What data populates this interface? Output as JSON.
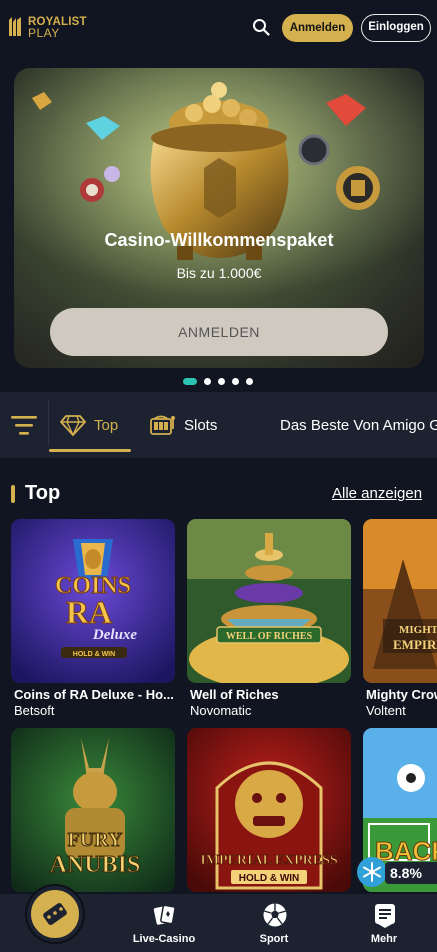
{
  "header": {
    "logo_line1": "ROYALIST",
    "logo_line2": "PLAY",
    "register_label": "Anmelden",
    "login_label": "Einloggen"
  },
  "banner": {
    "title": "Casino-Willkommenspaket",
    "subtitle": "Bis zu 1.000€",
    "cta_label": "ANMELDEN",
    "slides_total": 5,
    "active_slide": 1
  },
  "categories": [
    {
      "label": "Top",
      "icon": "diamond-icon",
      "active": true
    },
    {
      "label": "Slots",
      "icon": "slot-machine-icon",
      "active": false
    },
    {
      "label": "Das Beste Von Amigo G",
      "icon": "",
      "active": false
    }
  ],
  "section": {
    "title": "Top",
    "see_all_label": "Alle anzeigen"
  },
  "games": [
    {
      "name": "Coins of RA Deluxe - Ho...",
      "provider": "Betsoft",
      "art_text": [
        "COINS",
        "RA",
        "Deluxe",
        "HOLD & WIN"
      ]
    },
    {
      "name": "Well of Riches",
      "provider": "Novomatic",
      "art_text": [
        "WELL OF RICHES"
      ]
    },
    {
      "name": "Mighty Crow",
      "provider": "Voltent",
      "art_text": [
        "MIGHTY",
        "EMPIRE"
      ]
    },
    {
      "name": "",
      "provider": "",
      "art_text": [
        "FURY",
        "ANUBIS"
      ]
    },
    {
      "name": "",
      "provider": "",
      "art_text": [
        "IMPERIAL EXPRESS",
        "HOLD & WIN"
      ]
    },
    {
      "name": "",
      "provider": "",
      "art_text": [
        "BACK"
      ]
    }
  ],
  "cashback": {
    "percent": "8.8%"
  },
  "bottom_nav": [
    {
      "label": "",
      "icon": "dice-icon"
    },
    {
      "label": "Live-Casino",
      "icon": "cards-icon"
    },
    {
      "label": "Sport",
      "icon": "soccer-ball-icon"
    },
    {
      "label": "Mehr",
      "icon": "menu-list-icon"
    }
  ],
  "colors": {
    "background": "#101521",
    "panel": "#1c2230",
    "gold": "#d4b04e",
    "teal": "#2ec4b4"
  }
}
